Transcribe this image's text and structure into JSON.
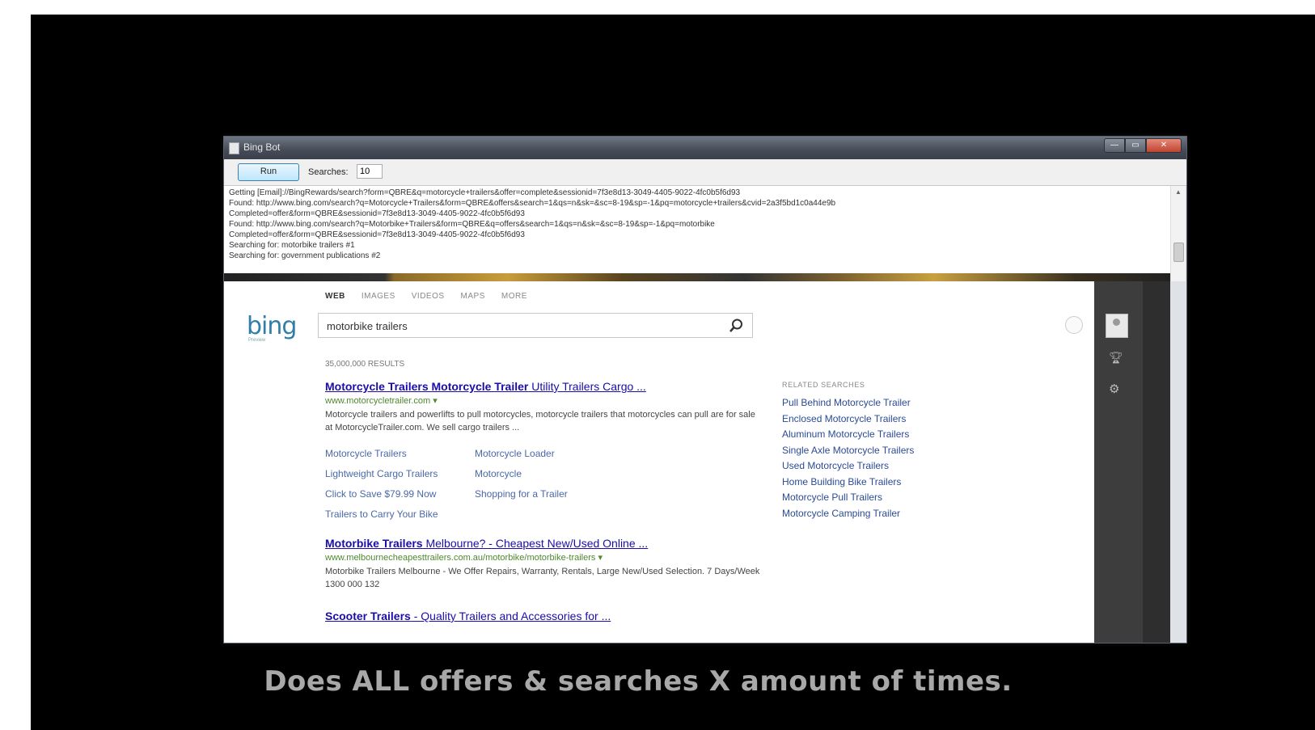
{
  "window": {
    "title": "Bing Bot",
    "minimize": "—",
    "maximize": "▭",
    "close": "✕"
  },
  "toolbar": {
    "run_label": "Run",
    "searches_label": "Searches:",
    "searches_value": "10"
  },
  "log": [
    "Getting [Email]://BingRewards/search?form=QBRE&q=motorcycle+trailers&offer=complete&sessionid=7f3e8d13-3049-4405-9022-4fc0b5f6d93",
    "Found: http://www.bing.com/search?q=Motorcycle+Trailers&form=QBRE&offers&search=1&qs=n&sk=&sc=8-19&sp=-1&pq=motorcycle+trailers&cvid=2a3f5bd1c0a44e9b",
    "Completed=offer&form=QBRE&sessionid=7f3e8d13-3049-4405-9022-4fc0b5f6d93",
    "Found: http://www.bing.com/search?q=Motorbike+Trailers&form=QBRE&q=offers&search=1&qs=n&sk=&sc=8-19&sp=-1&pq=motorbike",
    "Completed=offer&form=QBRE&sessionid=7f3e8d13-3049-4405-9022-4fc0b5f6d93",
    "Searching for: motorbike trailers #1",
    "Searching for: government publications #2"
  ],
  "bing": {
    "logo": "bing",
    "logo_sub": "Preview",
    "nav": [
      "WEB",
      "IMAGES",
      "VIDEOS",
      "MAPS",
      "MORE"
    ],
    "query": "motorbike trailers",
    "results_count": "35,000,000 RESULTS",
    "results": [
      {
        "title_bold": "Motorcycle Trailers Motorcycle Trailer",
        "title_rest": " Utility Trailers Cargo ...",
        "url": "www.motorcycletrailer.com ▾",
        "snippet": "Motorcycle trailers and powerlifts to pull motorcycles, motorcycle trailers that motorcycles can pull are for sale at MotorcycleTrailer.com. We sell cargo trailers ..."
      },
      {
        "title_bold": "Motorbike Trailers",
        "title_rest": " Melbourne? - Cheapest New/Used Online ...",
        "url": "www.melbournecheapesttrailers.com.au/motorbike/motorbike-trailers ▾",
        "snippet": "Motorbike Trailers Melbourne - We Offer Repairs, Warranty, Rentals, Large New/Used Selection. 7 Days/Week 1300 000 132"
      },
      {
        "title_bold": "Scooter Trailers",
        "title_rest": " - Quality Trailers and Accessories for ...",
        "url": "",
        "snippet": ""
      }
    ],
    "deep_links": [
      "Motorcycle Trailers",
      "Motorcycle Loader",
      "Lightweight Cargo Trailers",
      "Motorcycle",
      "Click to Save $79.99 Now",
      "Shopping for a Trailer",
      "Trailers to Carry Your Bike"
    ],
    "related_heading": "RELATED SEARCHES",
    "related": [
      "Pull Behind Motorcycle Trailer",
      "Enclosed Motorcycle Trailers",
      "Aluminum Motorcycle Trailers",
      "Single Axle Motorcycle Trailers",
      "Used Motorcycle Trailers",
      "Home Building Bike Trailers",
      "Motorcycle Pull Trailers",
      "Motorcycle Camping Trailer"
    ]
  },
  "caption": "Does ALL offers & searches X amount of times."
}
